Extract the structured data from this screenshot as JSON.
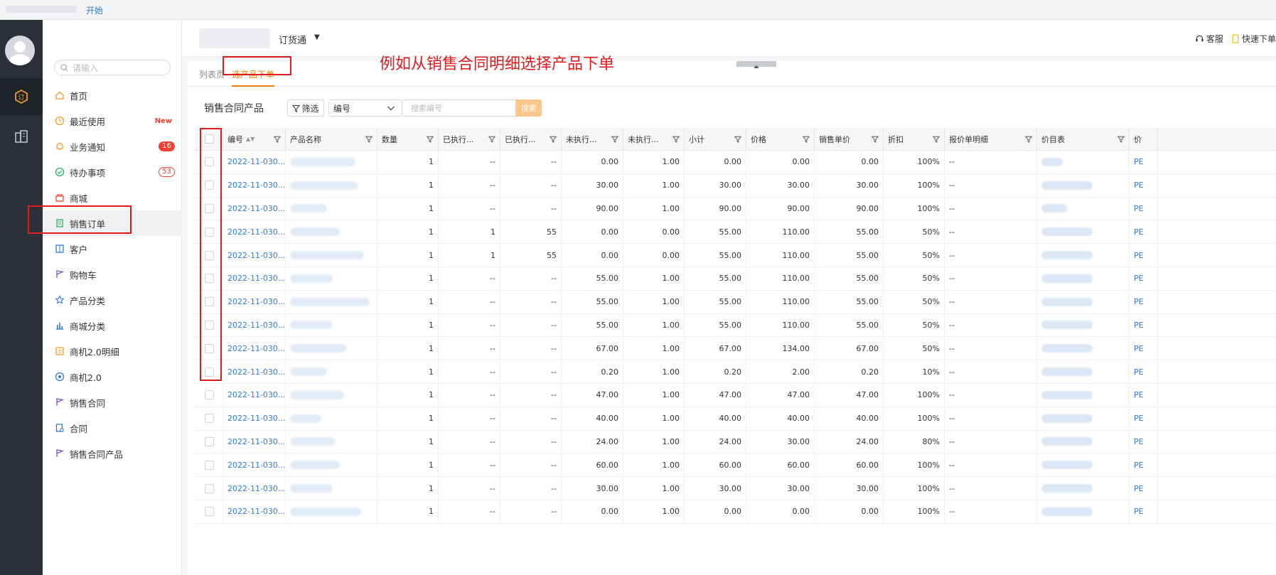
{
  "topbar": {
    "start_label": "开始"
  },
  "header": {
    "app_name": "订货通",
    "service_label": "客服",
    "quick_order_label": "快速下单"
  },
  "sidebar": {
    "search_placeholder": "请输入",
    "items": [
      {
        "label": "首页",
        "icon": "home-icon"
      },
      {
        "label": "最近使用",
        "icon": "clock-icon",
        "badge_new": "New"
      },
      {
        "label": "业务通知",
        "icon": "bell-icon",
        "badge": "16"
      },
      {
        "label": "待办事项",
        "icon": "check-circle-icon",
        "badge_outline": "53"
      },
      {
        "label": "商城",
        "icon": "shop-icon"
      },
      {
        "label": "销售订单",
        "icon": "order-doc-icon"
      },
      {
        "label": "客户",
        "icon": "contacts-icon"
      },
      {
        "label": "购物车",
        "icon": "flag-icon"
      },
      {
        "label": "产品分类",
        "icon": "star-icon"
      },
      {
        "label": "商城分类",
        "icon": "bar-chart-icon"
      },
      {
        "label": "商机2.0明细",
        "icon": "opportunity-icon"
      },
      {
        "label": "商机2.0",
        "icon": "target-icon"
      },
      {
        "label": "销售合同",
        "icon": "flag-icon"
      },
      {
        "label": "合同",
        "icon": "contract-icon"
      },
      {
        "label": "销售合同产品",
        "icon": "flag-icon"
      }
    ]
  },
  "tabs": {
    "list_page": "列表页",
    "select_products": "选产品下单"
  },
  "annotation": "例如从销售合同明细选择产品下单",
  "toolbar": {
    "title": "销售合同产品",
    "filter_label": "筛选",
    "field_select": "编号",
    "search_placeholder": "搜索编号",
    "search_button": "搜索"
  },
  "table": {
    "columns": [
      "编号",
      "产品名称",
      "数量",
      "已执行...",
      "已执行...",
      "未执行...",
      "未执行...",
      "小计",
      "价格",
      "销售单价",
      "折扣",
      "报价单明细",
      "价目表",
      "价"
    ],
    "rows": [
      {
        "id": "2022-11-030...",
        "qty": "1",
        "exec1": "--",
        "exec2": "--",
        "unexec1": "0.00",
        "unexec2": "1.00",
        "subtotal": "0.00",
        "price": "0.00",
        "unit_price": "0.00",
        "discount": "100%",
        "quote": "--",
        "pe": "PE"
      },
      {
        "id": "2022-11-030...",
        "qty": "1",
        "exec1": "--",
        "exec2": "--",
        "unexec1": "30.00",
        "unexec2": "1.00",
        "subtotal": "30.00",
        "price": "30.00",
        "unit_price": "30.00",
        "discount": "100%",
        "quote": "--",
        "pe": "PE"
      },
      {
        "id": "2022-11-030...",
        "qty": "1",
        "exec1": "--",
        "exec2": "--",
        "unexec1": "90.00",
        "unexec2": "1.00",
        "subtotal": "90.00",
        "price": "90.00",
        "unit_price": "90.00",
        "discount": "100%",
        "quote": "--",
        "pe": "PE"
      },
      {
        "id": "2022-11-030...",
        "qty": "1",
        "exec1": "1",
        "exec2": "55",
        "unexec1": "0.00",
        "unexec2": "0.00",
        "subtotal": "55.00",
        "price": "110.00",
        "unit_price": "55.00",
        "discount": "50%",
        "quote": "--",
        "pe": "PE"
      },
      {
        "id": "2022-11-030...",
        "qty": "1",
        "exec1": "1",
        "exec2": "55",
        "unexec1": "0.00",
        "unexec2": "0.00",
        "subtotal": "55.00",
        "price": "110.00",
        "unit_price": "55.00",
        "discount": "50%",
        "quote": "--",
        "pe": "PE"
      },
      {
        "id": "2022-11-030...",
        "qty": "1",
        "exec1": "--",
        "exec2": "--",
        "unexec1": "55.00",
        "unexec2": "1.00",
        "subtotal": "55.00",
        "price": "110.00",
        "unit_price": "55.00",
        "discount": "50%",
        "quote": "--",
        "pe": "PE"
      },
      {
        "id": "2022-11-030...",
        "qty": "1",
        "exec1": "--",
        "exec2": "--",
        "unexec1": "55.00",
        "unexec2": "1.00",
        "subtotal": "55.00",
        "price": "110.00",
        "unit_price": "55.00",
        "discount": "50%",
        "quote": "--",
        "pe": "PE"
      },
      {
        "id": "2022-11-030...",
        "qty": "1",
        "exec1": "--",
        "exec2": "--",
        "unexec1": "55.00",
        "unexec2": "1.00",
        "subtotal": "55.00",
        "price": "110.00",
        "unit_price": "55.00",
        "discount": "50%",
        "quote": "--",
        "pe": "PE"
      },
      {
        "id": "2022-11-030...",
        "qty": "1",
        "exec1": "--",
        "exec2": "--",
        "unexec1": "67.00",
        "unexec2": "1.00",
        "subtotal": "67.00",
        "price": "134.00",
        "unit_price": "67.00",
        "discount": "50%",
        "quote": "--",
        "pe": "PE"
      },
      {
        "id": "2022-11-030...",
        "qty": "1",
        "exec1": "--",
        "exec2": "--",
        "unexec1": "0.20",
        "unexec2": "1.00",
        "subtotal": "0.20",
        "price": "2.00",
        "unit_price": "0.20",
        "discount": "10%",
        "quote": "--",
        "pe": "PE"
      },
      {
        "id": "2022-11-030...",
        "qty": "1",
        "exec1": "--",
        "exec2": "--",
        "unexec1": "47.00",
        "unexec2": "1.00",
        "subtotal": "47.00",
        "price": "47.00",
        "unit_price": "47.00",
        "discount": "100%",
        "quote": "--",
        "pe": "PE"
      },
      {
        "id": "2022-11-030...",
        "qty": "1",
        "exec1": "--",
        "exec2": "--",
        "unexec1": "40.00",
        "unexec2": "1.00",
        "subtotal": "40.00",
        "price": "40.00",
        "unit_price": "40.00",
        "discount": "100%",
        "quote": "--",
        "pe": "PE"
      },
      {
        "id": "2022-11-030...",
        "qty": "1",
        "exec1": "--",
        "exec2": "--",
        "unexec1": "24.00",
        "unexec2": "1.00",
        "subtotal": "24.00",
        "price": "30.00",
        "unit_price": "24.00",
        "discount": "80%",
        "quote": "--",
        "pe": "PE"
      },
      {
        "id": "2022-11-030...",
        "qty": "1",
        "exec1": "--",
        "exec2": "--",
        "unexec1": "60.00",
        "unexec2": "1.00",
        "subtotal": "60.00",
        "price": "60.00",
        "unit_price": "60.00",
        "discount": "100%",
        "quote": "--",
        "pe": "PE"
      },
      {
        "id": "2022-11-030...",
        "qty": "1",
        "exec1": "--",
        "exec2": "--",
        "unexec1": "30.00",
        "unexec2": "1.00",
        "subtotal": "30.00",
        "price": "30.00",
        "unit_price": "30.00",
        "discount": "100%",
        "quote": "--",
        "pe": "PE"
      },
      {
        "id": "2022-11-030...",
        "qty": "1",
        "exec1": "--",
        "exec2": "--",
        "unexec1": "0.00",
        "unexec2": "1.00",
        "subtotal": "0.00",
        "price": "0.00",
        "unit_price": "0.00",
        "discount": "100%",
        "quote": "--",
        "pe": "PE"
      }
    ]
  },
  "colors": {
    "accent": "#f57c00",
    "link": "#2f7bd8",
    "annotation": "#e11b1b",
    "badge": "#f04134"
  }
}
